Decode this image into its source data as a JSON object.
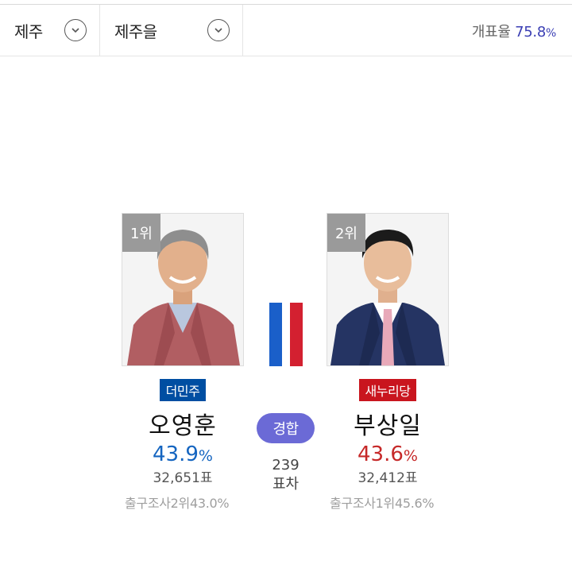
{
  "filters": {
    "region": "제주",
    "district": "제주을"
  },
  "count": {
    "label": "개표율",
    "value": "75.8",
    "unit": "%"
  },
  "candidates": [
    {
      "rank": "1위",
      "party": "더민주",
      "party_color": "#004ea2",
      "name": "오영훈",
      "percent": "43.9",
      "percent_unit": "%",
      "votes": "32,651표",
      "exit_poll": "출구조사2위43.0%"
    },
    {
      "rank": "2위",
      "party": "새누리당",
      "party_color": "#c9151e",
      "name": "부상일",
      "percent": "43.6",
      "percent_unit": "%",
      "votes": "32,412표",
      "exit_poll": "출구조사1위45.6%"
    }
  ],
  "race": {
    "status": "경합",
    "margin_value": "239",
    "margin_label": "표차"
  }
}
